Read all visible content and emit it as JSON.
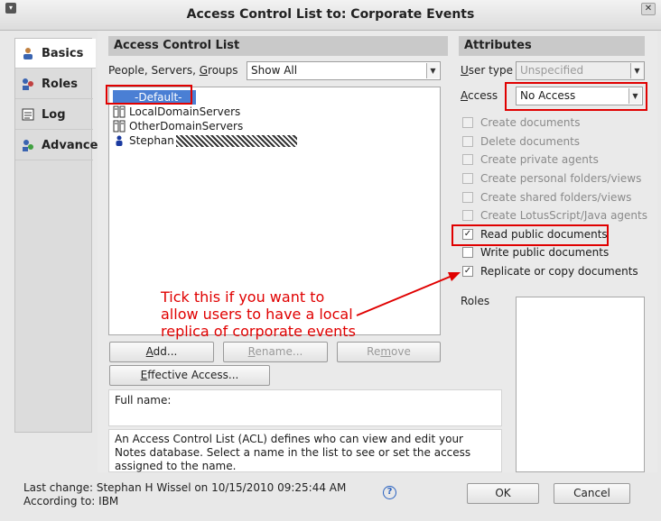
{
  "window": {
    "title": "Access Control List to: Corporate Events"
  },
  "tabs": [
    {
      "label": "Basics",
      "icon": "user-icon",
      "active": true
    },
    {
      "label": "Roles",
      "icon": "roles-icon",
      "active": false
    },
    {
      "label": "Log",
      "icon": "log-icon",
      "active": false
    },
    {
      "label": "Advanced",
      "icon": "advanced-icon",
      "active": false
    }
  ],
  "acl": {
    "header": "Access Control List",
    "filter_label": "People, Servers, Groups",
    "filter_value": "Show All",
    "entries": [
      {
        "name": "-Default-",
        "icon": "none",
        "selected": true
      },
      {
        "name": "LocalDomainServers",
        "icon": "server-group-icon",
        "selected": false
      },
      {
        "name": "OtherDomainServers",
        "icon": "server-group-icon",
        "selected": false
      },
      {
        "name": "Stephan",
        "icon": "person-icon",
        "selected": false
      }
    ],
    "buttons": {
      "add": "Add...",
      "rename": "Rename...",
      "remove": "Remove",
      "effective": "Effective Access..."
    },
    "full_name_label": "Full name:",
    "description": "An Access Control List (ACL) defines who can view and edit your Notes database.  Select a name in the list to see or set the access assigned to the name."
  },
  "attributes": {
    "header": "Attributes",
    "user_type_label": "User type",
    "user_type_value": "Unspecified",
    "access_label": "Access",
    "access_value": "No Access",
    "checkboxes": [
      {
        "label": "Create documents",
        "checked": false,
        "enabled": false
      },
      {
        "label": "Delete documents",
        "checked": false,
        "enabled": false
      },
      {
        "label": "Create private agents",
        "checked": false,
        "enabled": false
      },
      {
        "label": "Create personal folders/views",
        "checked": false,
        "enabled": false
      },
      {
        "label": "Create shared folders/views",
        "checked": false,
        "enabled": false
      },
      {
        "label": "Create LotusScript/Java agents",
        "checked": false,
        "enabled": false
      },
      {
        "label": "Read public documents",
        "checked": true,
        "enabled": true
      },
      {
        "label": "Write public documents",
        "checked": false,
        "enabled": true
      },
      {
        "label": "Replicate or copy documents",
        "checked": true,
        "enabled": true
      }
    ],
    "roles_label": "Roles"
  },
  "annotation": {
    "text_line1": "Tick this if you want to",
    "text_line2": "allow users to have a local",
    "text_line3": "replica of corporate events",
    "color": "#e00000"
  },
  "footer": {
    "last_change": "Last change: Stephan H Wissel on 10/15/2010 09:25:44 AM",
    "according_to": "According to: IBM",
    "ok": "OK",
    "cancel": "Cancel",
    "help_icon": "help-icon"
  }
}
